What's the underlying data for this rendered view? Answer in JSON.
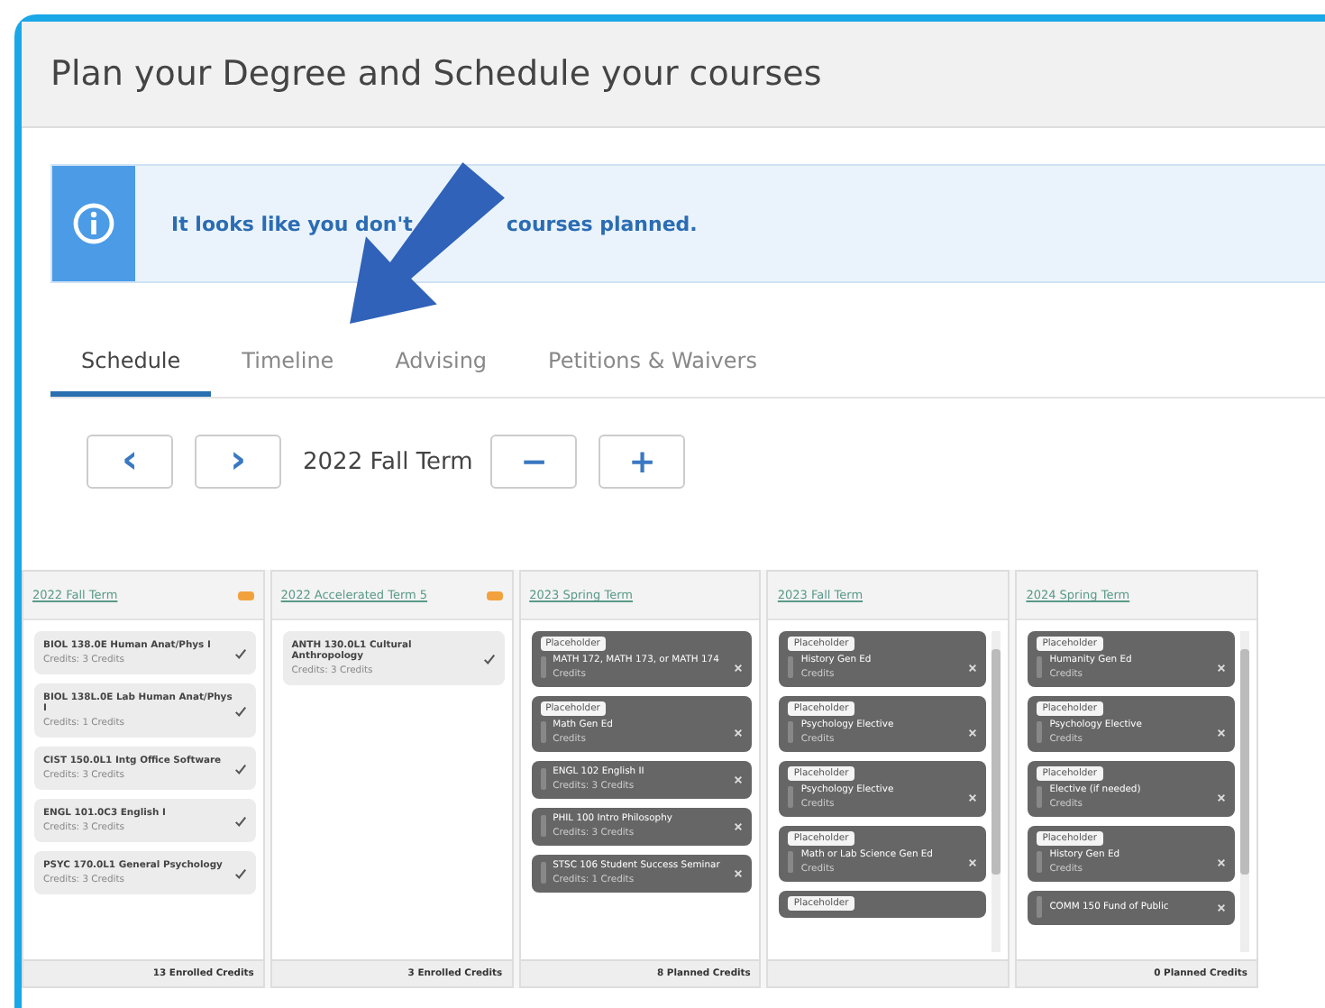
{
  "page": {
    "title": "Plan your Degree and Schedule your courses"
  },
  "banner": {
    "text_before": "It looks like you don't",
    "text_after": "courses planned."
  },
  "tabs": [
    {
      "label": "Schedule",
      "selected": true
    },
    {
      "label": "Timeline",
      "selected": false
    },
    {
      "label": "Advising",
      "selected": false
    },
    {
      "label": "Petitions & Waivers",
      "selected": false
    }
  ],
  "term_nav": {
    "prev": "‹",
    "next": "›",
    "term": "2022 Fall Term",
    "collapse": "−",
    "expand": "+"
  },
  "terms": [
    {
      "title": "2022 Fall Term",
      "badge": true,
      "scrollable": false,
      "footer": "13 Enrolled Credits",
      "courses": [
        {
          "kind": "completed",
          "name": "BIOL 138.0E Human Anat/Phys I",
          "credits": "Credits: 3 Credits"
        },
        {
          "kind": "completed",
          "name": "BIOL 138L.0E Lab Human Anat/Phys I",
          "credits": "Credits: 1 Credits"
        },
        {
          "kind": "completed",
          "name": "CIST 150.0L1 Intg Office Software",
          "credits": "Credits: 3 Credits"
        },
        {
          "kind": "completed",
          "name": "ENGL 101.0C3 English I",
          "credits": "Credits: 3 Credits"
        },
        {
          "kind": "completed",
          "name": "PSYC 170.0L1 General Psychology",
          "credits": "Credits: 3 Credits"
        }
      ]
    },
    {
      "title": "2022 Accelerated Term 5",
      "badge": true,
      "scrollable": false,
      "footer": "3 Enrolled Credits",
      "courses": [
        {
          "kind": "completed",
          "name": "ANTH 130.0L1 Cultural Anthropology",
          "credits": "Credits: 3 Credits"
        }
      ]
    },
    {
      "title": "2023 Spring Term",
      "badge": false,
      "scrollable": false,
      "footer": "8 Planned Credits",
      "courses": [
        {
          "kind": "planned",
          "tag": "Placeholder",
          "name": "MATH 172, MATH 173, or MATH 174",
          "credits": "Credits"
        },
        {
          "kind": "planned",
          "tag": "Placeholder",
          "name": "Math Gen Ed",
          "credits": "Credits"
        },
        {
          "kind": "planned",
          "name": "ENGL 102 English II",
          "credits": "Credits: 3 Credits"
        },
        {
          "kind": "planned",
          "name": "PHIL 100 Intro Philosophy",
          "credits": "Credits: 3 Credits"
        },
        {
          "kind": "planned",
          "name": "STSC 106 Student Success Seminar",
          "credits": "Credits: 1 Credits"
        }
      ]
    },
    {
      "title": "2023 Fall Term",
      "badge": false,
      "scrollable": true,
      "courses": [
        {
          "kind": "planned",
          "tag": "Placeholder",
          "name": "History Gen Ed",
          "credits": "Credits"
        },
        {
          "kind": "planned",
          "tag": "Placeholder",
          "name": "Psychology Elective",
          "credits": "Credits"
        },
        {
          "kind": "planned",
          "tag": "Placeholder",
          "name": "Psychology Elective",
          "credits": "Credits"
        },
        {
          "kind": "planned",
          "tag": "Placeholder",
          "name": "Math or Lab Science Gen Ed",
          "credits": "Credits"
        },
        {
          "kind": "planned",
          "tag": "Placeholder"
        }
      ]
    },
    {
      "title": "2024 Spring Term",
      "badge": false,
      "scrollable": true,
      "footer": "0 Planned Credits",
      "courses": [
        {
          "kind": "planned",
          "tag": "Placeholder",
          "name": "Humanity Gen Ed",
          "credits": "Credits"
        },
        {
          "kind": "planned",
          "tag": "Placeholder",
          "name": "Psychology Elective",
          "credits": "Credits"
        },
        {
          "kind": "planned",
          "tag": "Placeholder",
          "name": "Elective (if needed)",
          "credits": "Credits"
        },
        {
          "kind": "planned",
          "tag": "Placeholder",
          "name": "History Gen Ed",
          "credits": "Credits"
        },
        {
          "kind": "planned",
          "name": "COMM 150 Fund of Public"
        }
      ]
    }
  ]
}
